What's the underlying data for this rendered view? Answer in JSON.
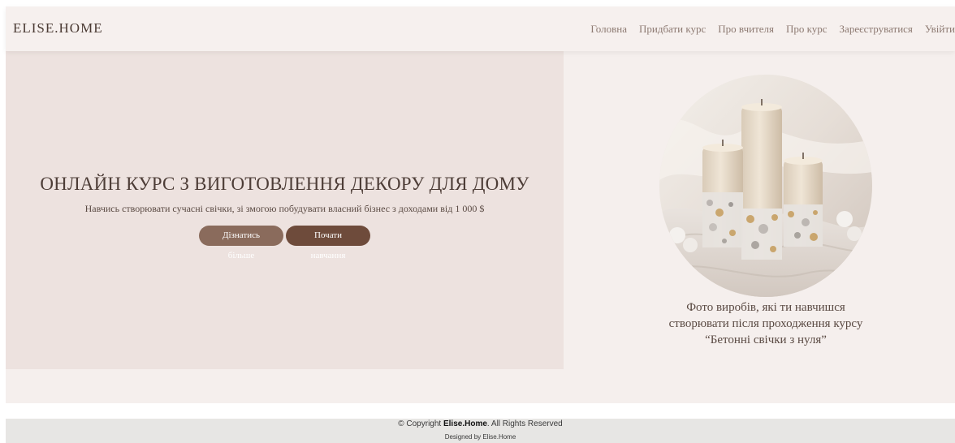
{
  "header": {
    "logo": "ELISE.HOME",
    "nav": [
      {
        "label": "Головна"
      },
      {
        "label": "Придбати курс"
      },
      {
        "label": "Про вчителя"
      },
      {
        "label": "Про курс"
      },
      {
        "label": "Зареєструватися"
      },
      {
        "label": "Увійти"
      }
    ]
  },
  "hero": {
    "title": "ОНЛАЙН КУРС З ВИГОТОВЛЕННЯ ДЕКОРУ ДЛЯ ДОМУ",
    "subtitle": "Навчись створювати сучасні свічки, зі змогою побудувати власний бізнес з доходами від 1 000 $",
    "learn_more_label": "Дізнатись більше",
    "start_label": "Почати навчання"
  },
  "photo": {
    "caption_lines": [
      "Фото виробів, які ти навчишся",
      "створювати після проходження курсу",
      "“Бетонні свічки з нуля”"
    ]
  },
  "footer": {
    "copyright_prefix": "© Copyright ",
    "brand": "Elise.Home",
    "copyright_suffix": ". All Rights Reserved",
    "designed_by": "Designed by Elise.Home"
  },
  "colors": {
    "header_bg": "#f6f0ee",
    "hero_left_bg": "#ede2df",
    "section_bg": "#f5efed",
    "button_learn": "#8a6b5c",
    "button_start": "#6e4b3b",
    "footer_bg": "#e7e6e4"
  }
}
